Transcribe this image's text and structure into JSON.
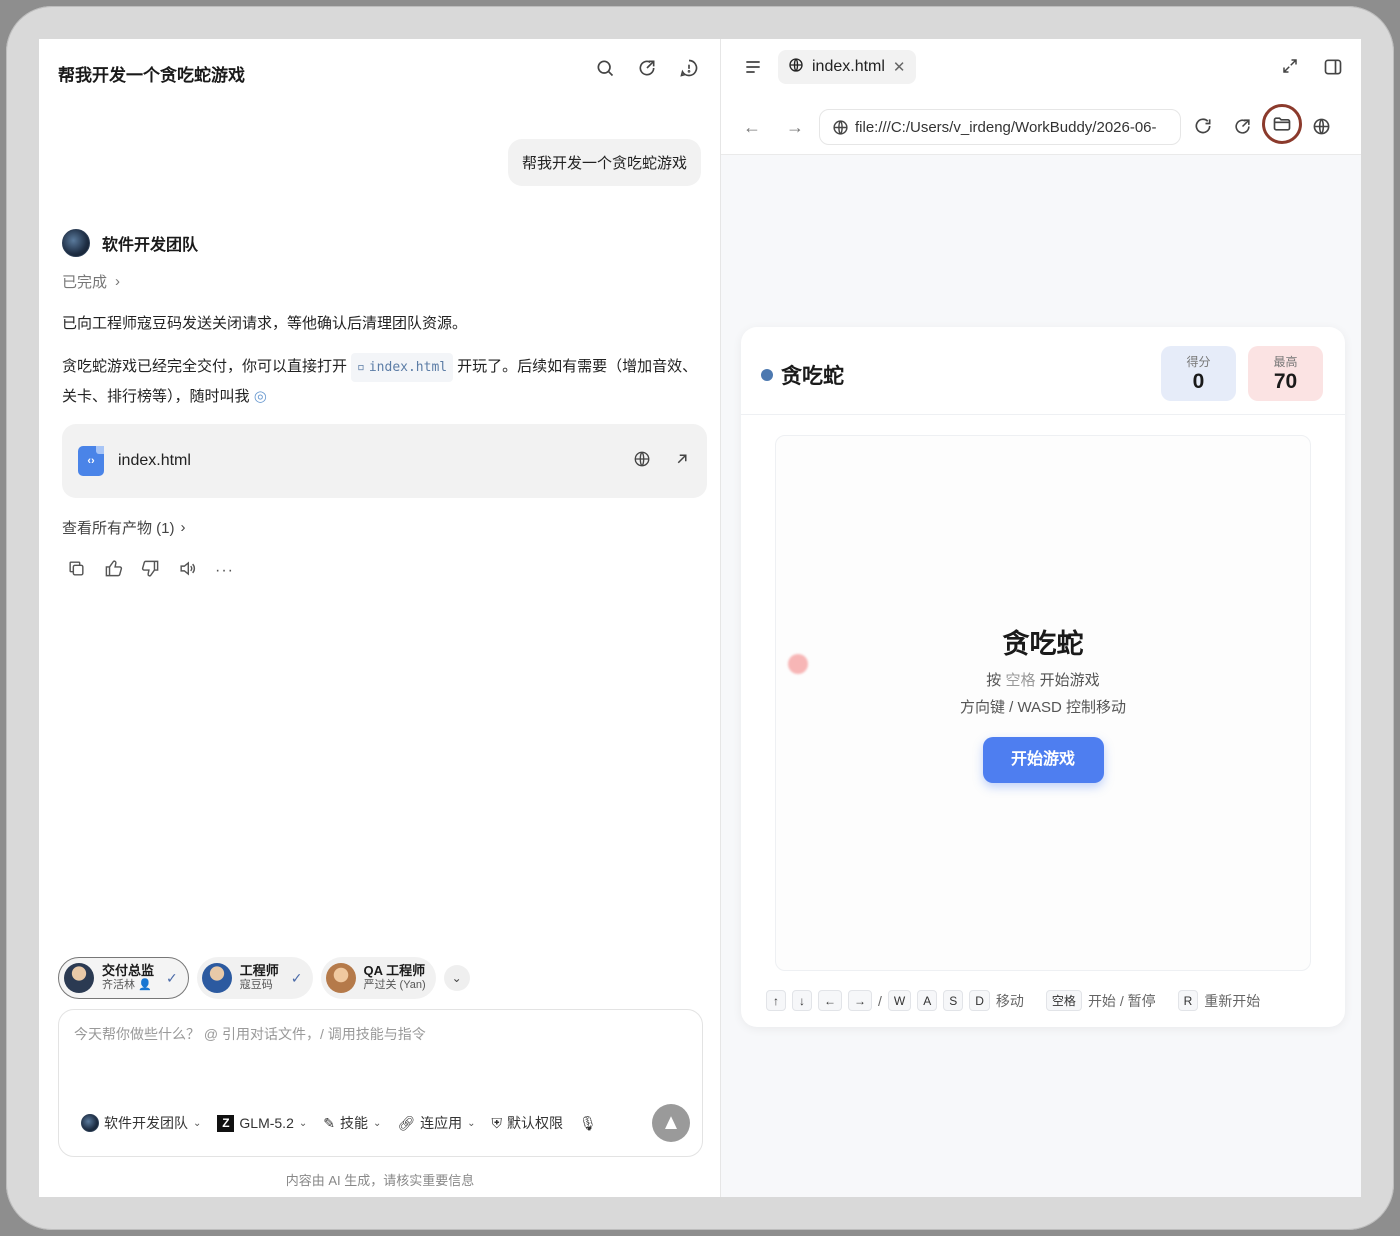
{
  "chat": {
    "title": "帮我开发一个贪吃蛇游戏",
    "user_message": "帮我开发一个贪吃蛇游戏",
    "agent_name": "软件开发团队",
    "status": "已完成",
    "para1": "已向工程师寇豆码发送关闭请求，等他确认后清理团队资源。",
    "para2_before": "贪吃蛇游戏已经完全交付，你可以直接打开",
    "para2_code": "index.html",
    "para2_after": "开玩了。后续如有需要（增加音效、关卡、排行榜等），随时叫我",
    "file_name": "index.html",
    "all_products": "查看所有产物 (1)",
    "agents": [
      {
        "role": "交付总监",
        "person": "齐活林",
        "checked": true
      },
      {
        "role": "工程师",
        "person": "寇豆码",
        "checked": true
      },
      {
        "role": "QA 工程师",
        "person": "严过关 (Yan)",
        "checked": false
      }
    ],
    "input_placeholder": "今天帮你做些什么？ @ 引用对话文件，/ 调用技能与指令",
    "toolbar": {
      "team": "软件开发团队",
      "model": "GLM-5.2",
      "skills": "技能",
      "apps": "连应用",
      "permission": "默认权限"
    },
    "footer": "内容由 AI 生成，请核实重要信息"
  },
  "browser": {
    "tab_title": "index.html",
    "url": "file:///C:/Users/v_irdeng/WorkBuddy/2026-06-"
  },
  "game": {
    "title": "贪吃蛇",
    "score_label": "得分",
    "score_value": "0",
    "best_label": "最高",
    "best_value": "70",
    "overlay_title": "贪吃蛇",
    "line1_a": "按",
    "line1_key": "空格",
    "line1_b": "开始游戏",
    "line2": "方向键 / WASD 控制移动",
    "start_button": "开始游戏",
    "keys": {
      "up": "↑",
      "down": "↓",
      "left": "←",
      "right": "→",
      "slash": "/",
      "w": "W",
      "a": "A",
      "s": "S",
      "d": "D",
      "move": "移动",
      "space": "空格",
      "start_pause": "开始 / 暂停",
      "r": "R",
      "restart": "重新开始"
    }
  },
  "colors": {
    "accent": "#4e7ef0",
    "score_bg": "#e6ecf9",
    "best_bg": "#fbe3e3",
    "highlight_ring": "#8b3a2c"
  }
}
